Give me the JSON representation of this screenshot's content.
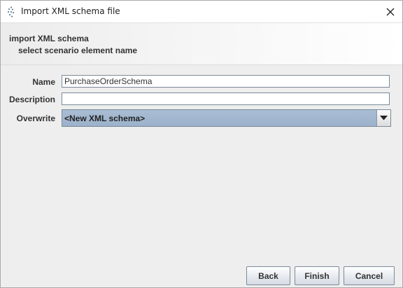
{
  "window": {
    "title": "Import XML schema file"
  },
  "header": {
    "title": "import XML schema",
    "subtitle": "select scenario element name"
  },
  "form": {
    "name_label": "Name",
    "name_value": "PurchaseOrderSchema",
    "description_label": "Description",
    "description_value": "",
    "overwrite_label": "Overwrite",
    "overwrite_selected": "<New XML schema>"
  },
  "buttons": {
    "back": "Back",
    "finish": "Finish",
    "cancel": "Cancel"
  },
  "icons": {
    "app": "app-logo-icon",
    "close": "close-icon",
    "dropdown": "chevron-down-icon"
  },
  "colors": {
    "combo_selected": "#9fb4cd"
  }
}
